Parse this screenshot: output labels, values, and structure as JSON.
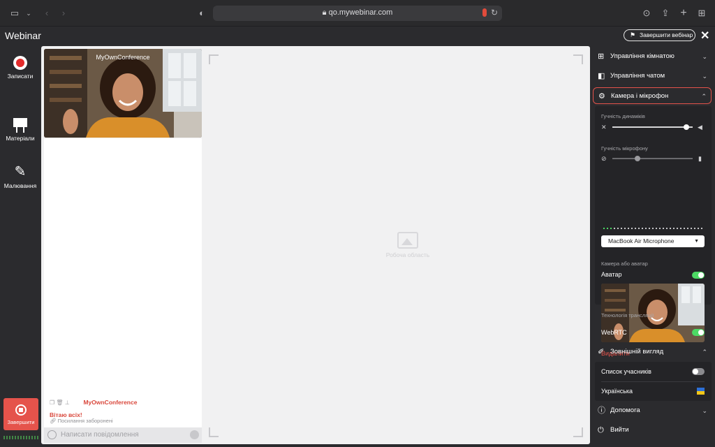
{
  "browser": {
    "url": "qo.mywebinar.com"
  },
  "app": {
    "title": "Webinar",
    "end_webinar_label": "Завершити вебінар"
  },
  "left_toolbar": {
    "record_label": "Записати",
    "materials_label": "Матеріали",
    "drawing_label": "Малювання",
    "finish_label": "Завершити"
  },
  "video": {
    "participant_name": "MyOwnConference"
  },
  "work_area": {
    "placeholder": "Робоча область"
  },
  "chat": {
    "message_author": "MyOwnConference",
    "message_text": "Вітаю всіх!",
    "links_forbidden": "Посилання заборонені",
    "input_placeholder": "Написати повідомлення"
  },
  "right_panel": {
    "room_management": "Управління кімнатою",
    "chat_management": "Управління чатом",
    "camera_mic": "Камера і мікрофон",
    "speaker_volume_label": "Гучність динаміків",
    "speaker_volume_level": 0.95,
    "mic_volume_label": "Гучність мікрофону",
    "mic_volume_level": 0.3,
    "mic_device": "MacBook Air Microphone",
    "camera_or_avatar_label": "Камера або аватар",
    "avatar_label": "Аватар",
    "avatar_enabled": true,
    "delete_label": "Видалити",
    "tech_label": "Технологія трансляції",
    "webrtc_label": "WebRTC",
    "webrtc_enabled": true,
    "appearance": "Зовнішній вигляд",
    "participants_list": "Список учасників",
    "participants_list_enabled": false,
    "language": "Українська",
    "help": "Допомога",
    "exit": "Вийти"
  },
  "colors": {
    "accent": "#e5534b",
    "toggle_on": "#4cd964",
    "panel_bg": "#2b2b2e"
  }
}
